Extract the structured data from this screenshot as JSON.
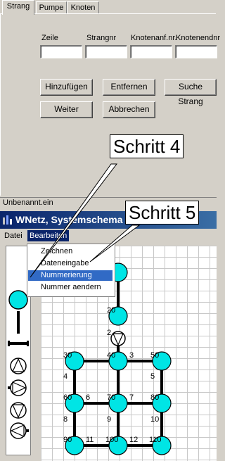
{
  "dialog": {
    "tabs": [
      "Strang",
      "Pumpe",
      "Knoten"
    ],
    "active_tab": "Strang",
    "fields": {
      "zeile": {
        "label": "Zeile",
        "value": ""
      },
      "strangnr": {
        "label": "Strangnr",
        "value": ""
      },
      "knotenanf": {
        "label": "Knotenanf.nr.",
        "value": ""
      },
      "knotenend": {
        "label": "Knotenendnr",
        "value": ""
      }
    },
    "buttons": {
      "hinzufuegen": "Hinzufügen",
      "entfernen": "Entfernen",
      "suche_strang": "Suche Strang",
      "weiter": "Weiter",
      "abbrechen": "Abbrechen"
    },
    "status": "Unbenannt.ein"
  },
  "callouts": {
    "schritt4": "Schritt 4",
    "schritt5": "Schritt 5"
  },
  "window": {
    "title": "WNetz, Systemschema",
    "menu": [
      "Datei",
      "Bearbeiten"
    ],
    "open_menu": "Bearbeiten",
    "dropdown": [
      "Zeichnen",
      "Dateneingabe",
      "Nummerierung",
      "Nummer aendern"
    ],
    "highlighted": "Nummerierung",
    "palette_icons": [
      "node-circle-icon",
      "pipe-vertical-icon",
      "pipe-horizontal-icon",
      "pump-up-icon",
      "pump-right-icon",
      "pump-down-icon",
      "pump-left-icon"
    ],
    "node_color": "#00e5e5",
    "schema_numbers": {
      "n20": "20",
      "n2": "2",
      "n30": "30",
      "n40": "40",
      "n3": "3",
      "n50": "50",
      "n4": "4",
      "n5": "5",
      "n60": "60",
      "n6": "6",
      "n70": "70",
      "n7": "7",
      "n80": "80",
      "n8": "8",
      "n9": "9",
      "n10": "10",
      "n90": "90",
      "n11": "11",
      "n100": "100",
      "n12": "12",
      "n110": "110"
    }
  }
}
